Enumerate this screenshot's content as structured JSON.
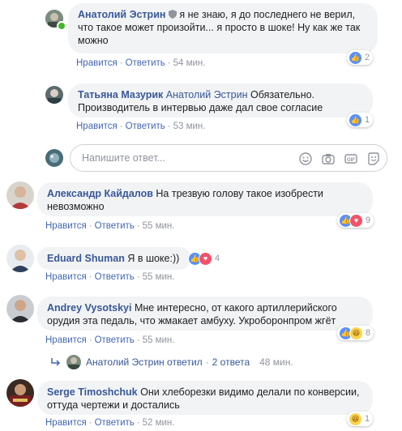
{
  "actions": {
    "like": "Нравится",
    "reply": "Ответить",
    "separator": "·"
  },
  "comments": [
    {
      "author": "Анатолий Эстрин",
      "text": "я не знаю, я до последнего не верил, что такое может произойти... я просто в шоке! Ну как же так можно",
      "time": "54 мин.",
      "reaction_count": "2"
    },
    {
      "author": "Татьяна Мазурик",
      "mention": "Анатолий Эстрин",
      "text": "Обязательно. Производитель в интервью даже дал свое согласие",
      "time": "53 мин.",
      "reaction_count": "1"
    },
    {
      "author": "Александр Кайдалов",
      "text": "На трезвую голову такое изобрести невозможно",
      "time": "55 мин.",
      "reaction_count": "9"
    },
    {
      "author": "Eduard Shuman",
      "text": "Я в шоке:))",
      "time": "55 мин.",
      "reaction_count": "4"
    },
    {
      "author": "Andrey Vysotskyi",
      "text": "Мне интересно, от какого артиллерийского орудия эта педаль, что жмакает амбуху. Укроборонпром жгёт",
      "time": "55 мин.",
      "reaction_count": "8"
    },
    {
      "author": "Serge Timoshchuk",
      "text": "Они хлеборезки видимо делали по конверсии, оттуда чертежи и достались",
      "time": "52 мин.",
      "reaction_count": "1"
    }
  ],
  "composer": {
    "placeholder": "Напишите ответ..."
  },
  "replies_link": {
    "author": "Анатолий Эстрин",
    "replied": "ответил",
    "count": "2 ответа",
    "time": "48 мин."
  },
  "colors": {
    "link": "#385898",
    "action": "#4267b2",
    "bubble": "#f2f3f5",
    "like": "#5890ff",
    "love": "#f25268"
  }
}
